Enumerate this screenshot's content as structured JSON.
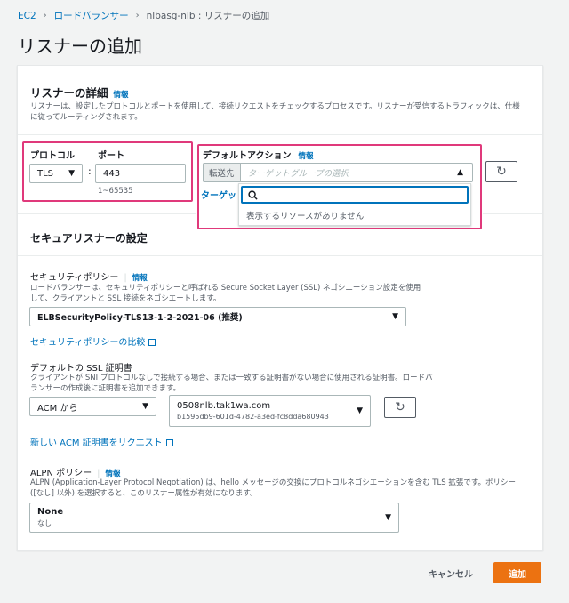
{
  "breadcrumb": {
    "item1": "EC2",
    "item2": "ロードバランサー",
    "current": "nlbasg-nlb : リスナーの追加",
    "sep": "›"
  },
  "page_title": "リスナーの追加",
  "listener": {
    "title": "リスナーの詳細",
    "info": "情報",
    "description": "リスナーは、設定したプロトコルとポートを使用して、接続リクエストをチェックするプロセスです。リスナーが受信するトラフィックは、仕様に従ってルーティングされます。",
    "protocol_label": "プロトコル",
    "protocol_value": "TLS",
    "colon": ":",
    "port_label": "ポート",
    "port_value": "443",
    "port_hint": "1~65535",
    "default_action_label": "デフォルトアクション",
    "default_action_info": "情報",
    "forward_label": "転送先",
    "target_group_placeholder": "ターゲットグループの選択",
    "target_link_partial": "ターゲッ",
    "search_placeholder": "",
    "no_resources": "表示するリソースがありません"
  },
  "secure": {
    "title": "セキュアリスナーの設定",
    "policy_label": "セキュリティポリシー",
    "policy_info": "情報",
    "policy_desc": "ロードバランサーは、セキュリティポリシーと呼ばれる Secure Socket Layer (SSL) ネゴシエーション設定を使用して、クライアントと SSL 接続をネゴシエートします。",
    "policy_value": "ELBSecurityPolicy-TLS13-1-2-2021-06 (推奨)",
    "compare_link": "セキュリティポリシーの比較",
    "cert_label": "デフォルトの SSL 証明書",
    "cert_desc": "クライアントが SNI プロトコルなしで接続する場合、または一致する証明書がない場合に使用される証明書。ロードバランサーの作成後に証明書を追加できます。",
    "cert_source": "ACM から",
    "cert_name": "0508nlb.tak1wa.com",
    "cert_id": "b1595db9-601d-4782-a3ed-fc8dda680943",
    "request_link": "新しい ACM 証明書をリクエスト",
    "alpn_label": "ALPN ポリシー",
    "alpn_info": "情報",
    "alpn_desc": "ALPN (Application-Layer Protocol Negotiation) は、hello メッセージの交換にプロトコルネゴシエーションを含む TLS 拡張です。ポリシー ([なし] 以外) を選択すると、このリスナー属性が有効になります。",
    "alpn_value": "None",
    "alpn_sub": "なし"
  },
  "footer": {
    "cancel": "キャンセル",
    "add": "追加"
  },
  "colors": {
    "accent": "#ec7211",
    "link": "#0073bb",
    "highlight": "#e0397b"
  },
  "icons": {
    "refresh": "refresh-icon",
    "external": "external-link-icon",
    "search": "search-icon"
  }
}
